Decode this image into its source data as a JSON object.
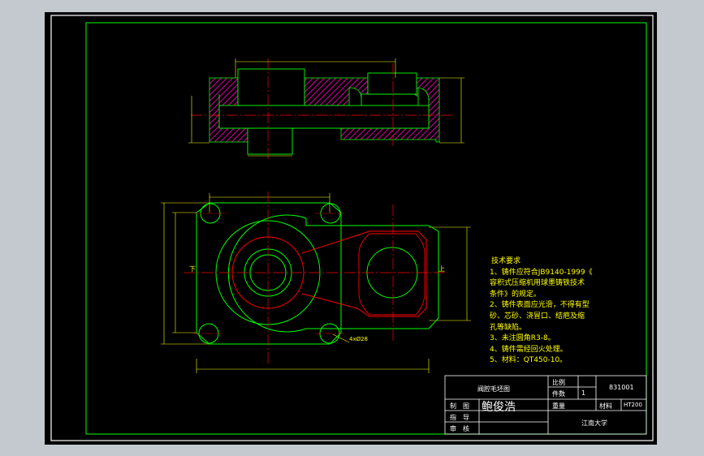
{
  "colors": {
    "background": "#000000",
    "frame": "#00ff00",
    "part_outline": "#00ff00",
    "section_hatch": "#cc0099",
    "centerline": "#ff0000",
    "dimension": "#ffff00",
    "text": "#ffffff",
    "viewport": "#c4c9d0"
  },
  "views": {
    "plan_view": {
      "label_left": "下",
      "label_right": "上",
      "hole_callout": "4xØ28"
    }
  },
  "notes": {
    "title": "技术要求",
    "items": [
      "1、铸件应符合JB9140-1999《",
      "容积式压缩机用球墨铸铁技术",
      "条件》的规定。",
      "2、铸件表面应光滑，不得有型",
      "砂、芯砂、浇冒口、结疤及缩",
      "孔等缺陷。",
      "3、未注圆角R3-8。",
      "4、铸件需经回火处理。",
      "5、材料：QT450-10。"
    ]
  },
  "title_block": {
    "drawing_name": "阀腔毛坯图",
    "scale_label": "比例",
    "quantity_label": "件数",
    "quantity": "1",
    "drawing_no": "831001",
    "drawn_label": "制　图",
    "drawn_by": "鲍俊浩",
    "checked_label": "指　导",
    "approved_label": "审　核",
    "weight_label": "重量",
    "material_label": "材料",
    "material": "HT200",
    "organization": "江南大学"
  }
}
